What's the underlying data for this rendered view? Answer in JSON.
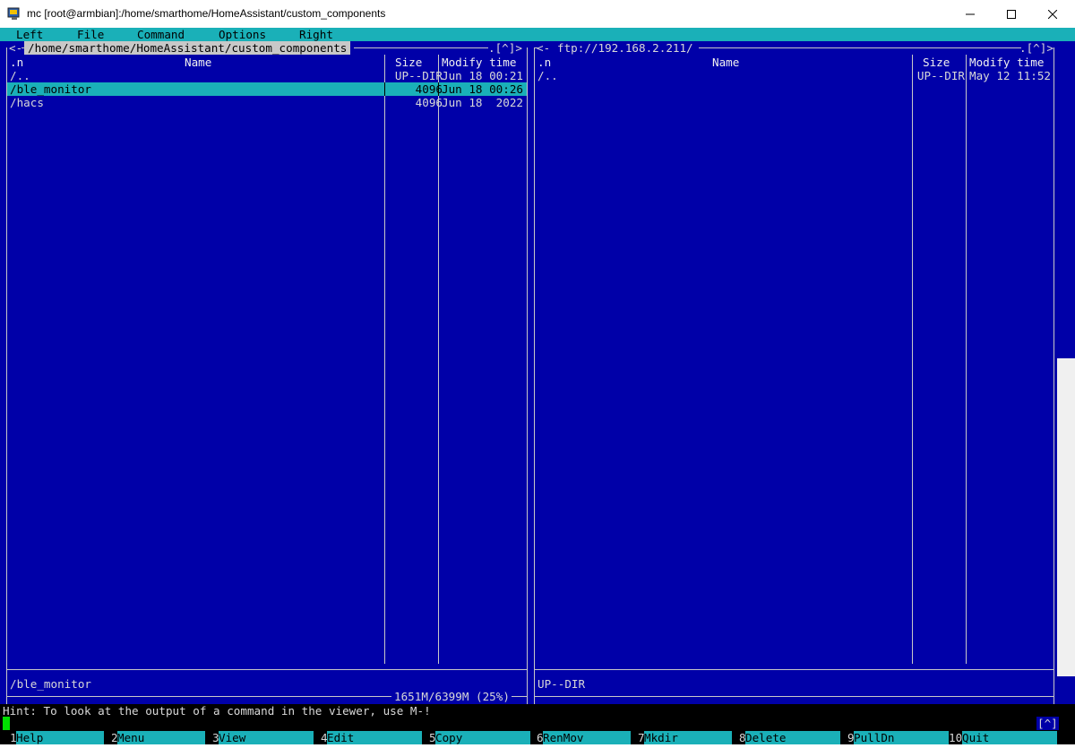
{
  "window": {
    "title": "mc [root@armbian]:/home/smarthome/HomeAssistant/custom_components"
  },
  "menu": [
    "Left",
    "File",
    "Command",
    "Options",
    "Right"
  ],
  "left_panel": {
    "path": "/home/smarthome/HomeAssistant/custom_components",
    "corner_prefix": "<-",
    "corner_suffix": ".[^]>",
    "sort_indicator": ".n",
    "columns": {
      "name": "Name",
      "size": "Size",
      "mtime": "Modify time"
    },
    "files": [
      {
        "name": "/..",
        "size": "UP--DIR",
        "mtime": "Jun 18 00:21"
      },
      {
        "name": "/ble_monitor",
        "size": "4096",
        "mtime": "Jun 18 00:26"
      },
      {
        "name": "/hacs",
        "size": "4096",
        "mtime": "Jun 18  2022"
      }
    ],
    "selected_index": 1,
    "mini_status": "/ble_monitor",
    "disk_info": "1651M/6399M (25%)"
  },
  "right_panel": {
    "path": "ftp://192.168.2.211/",
    "corner_prefix": "<-",
    "corner_suffix": ".[^]>",
    "sort_indicator": ".n",
    "columns": {
      "name": "Name",
      "size": "Size",
      "mtime": "Modify time"
    },
    "files": [
      {
        "name": "/..",
        "size": "UP--DIR",
        "mtime": "May 12 11:52"
      }
    ],
    "mini_status": "UP--DIR"
  },
  "hint": "Hint: To look at the output of a command in the viewer, use M-!",
  "prompt_caret": "[^]",
  "fkeys": [
    {
      "num": "1",
      "label": "Help"
    },
    {
      "num": "2",
      "label": "Menu"
    },
    {
      "num": "3",
      "label": "View"
    },
    {
      "num": "4",
      "label": "Edit"
    },
    {
      "num": "5",
      "label": "Copy"
    },
    {
      "num": "6",
      "label": "RenMov"
    },
    {
      "num": "7",
      "label": "Mkdir"
    },
    {
      "num": "8",
      "label": "Delete"
    },
    {
      "num": "9",
      "label": "PullDn"
    },
    {
      "num": "10",
      "label": "Quit"
    }
  ],
  "colors": {
    "panel_bg": "#0000a8",
    "accent": "#1ab0b8",
    "text": "#d8d8d8",
    "cursor": "#00e000"
  }
}
